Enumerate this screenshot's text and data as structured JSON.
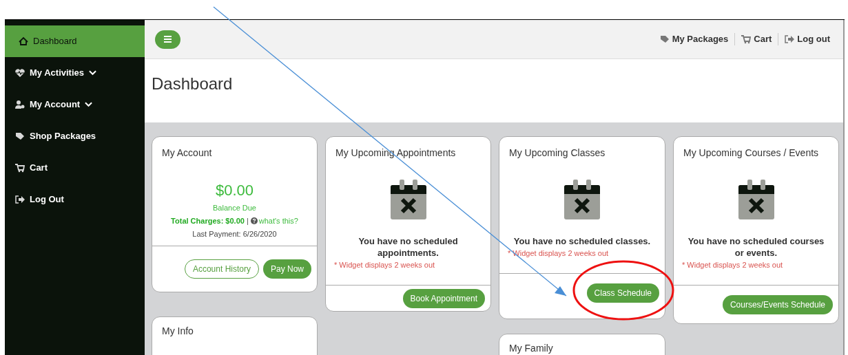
{
  "sidebar": {
    "items": [
      {
        "label": "Dashboard",
        "selected": true,
        "expandable": false
      },
      {
        "label": "My Activities",
        "selected": false,
        "expandable": true
      },
      {
        "label": "My Account",
        "selected": false,
        "expandable": true
      },
      {
        "label": "Shop Packages",
        "selected": false,
        "expandable": false
      },
      {
        "label": "Cart",
        "selected": false,
        "expandable": false
      },
      {
        "label": "Log Out",
        "selected": false,
        "expandable": false
      }
    ]
  },
  "top_bar": {
    "links": [
      "My Packages",
      "Cart",
      "Log out"
    ]
  },
  "page_title": "Dashboard",
  "columns": [
    {
      "cards": [
        {
          "kind": "account",
          "title": "My Account",
          "amount": "$0.00",
          "amount_label": "Balance Due",
          "total_charges": "Total Charges: $0.00",
          "separator": "|",
          "help_link": "what's this?",
          "last_payment": "Last Payment: 6/26/2020",
          "buttons": [
            {
              "label": "Account History",
              "kind": "outline"
            },
            {
              "label": "Pay Now",
              "kind": "filled"
            }
          ]
        },
        {
          "kind": "info",
          "title": "My Info"
        }
      ]
    },
    {
      "cards": [
        {
          "kind": "empty",
          "title": "My Upcoming Appointments",
          "message": "You have no scheduled appointments.",
          "note": "* Widget displays 2 weeks out",
          "buttons": [
            {
              "label": "Book Appointment",
              "kind": "filled"
            }
          ]
        }
      ]
    },
    {
      "cards": [
        {
          "kind": "empty",
          "title": "My Upcoming Classes",
          "message": "You have no scheduled classes.",
          "note": "* Widget displays 2 weeks out",
          "buttons": [
            {
              "label": "Class Schedule",
              "kind": "filled"
            }
          ]
        },
        {
          "kind": "info",
          "title": "My Family"
        }
      ]
    },
    {
      "cards": [
        {
          "kind": "empty",
          "title": "My Upcoming Courses / Events",
          "message": "You have no scheduled courses or events.",
          "note": "* Widget displays 2 weeks out",
          "buttons": [
            {
              "label": "Courses/Events Schedule",
              "kind": "filled"
            }
          ]
        }
      ]
    }
  ]
}
